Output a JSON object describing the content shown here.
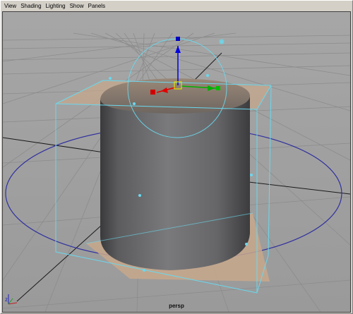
{
  "menu": {
    "items": [
      {
        "id": "view",
        "label": "View"
      },
      {
        "id": "shading",
        "label": "Shading"
      },
      {
        "id": "lighting",
        "label": "Lighting"
      },
      {
        "id": "show",
        "label": "Show"
      },
      {
        "id": "panels",
        "label": "Panels"
      }
    ]
  },
  "viewport": {
    "camera_label": "persp",
    "background_color": "#a0a0a0",
    "grid_color": "#8a8a8a",
    "selection_color": "#7fdcf0",
    "axis_labels": {
      "x": "x",
      "y": "y",
      "z": "z"
    }
  },
  "manipulator": {
    "x_axis_color": "#00b000",
    "y_axis_color": "#0000e0",
    "z_axis_color": "#e00000",
    "center_color": "#e0e000"
  }
}
